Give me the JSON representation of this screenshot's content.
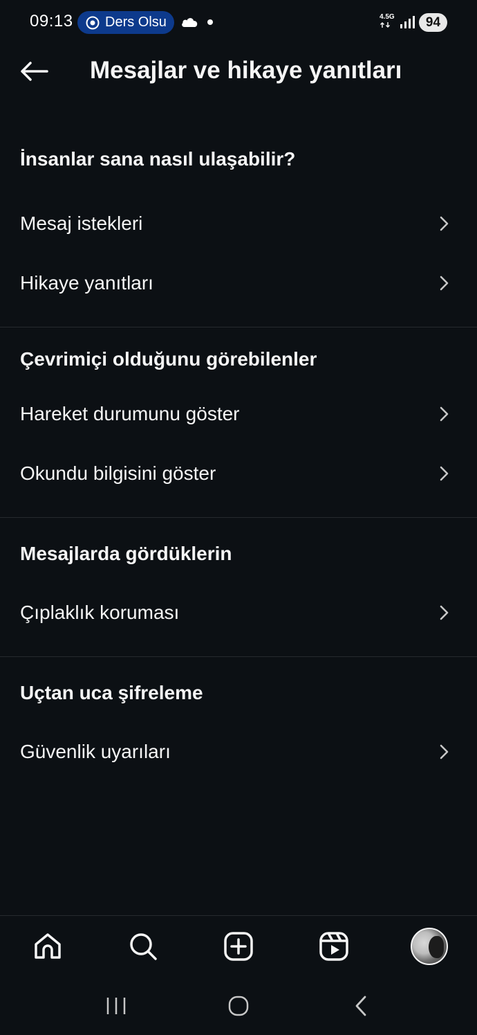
{
  "status_bar": {
    "time": "09:13",
    "pill_text": "Ders Olsu",
    "network": "4.5G",
    "battery": "94"
  },
  "header": {
    "title": "Mesajlar ve hikaye yanıtları"
  },
  "sections": [
    {
      "heading": "İnsanlar sana nasıl ulaşabilir?",
      "items": [
        {
          "label": "Mesaj istekleri"
        },
        {
          "label": "Hikaye yanıtları"
        }
      ]
    },
    {
      "heading": "Çevrimiçi olduğunu görebilenler",
      "items": [
        {
          "label": "Hareket durumunu göster"
        },
        {
          "label": "Okundu bilgisini göster"
        }
      ]
    },
    {
      "heading": "Mesajlarda gördüklerin",
      "items": [
        {
          "label": "Çıplaklık koruması"
        }
      ]
    },
    {
      "heading": "Uçtan uca şifreleme",
      "items": [
        {
          "label": "Güvenlik uyarıları"
        }
      ]
    }
  ],
  "bottom_nav": {
    "icons": [
      "home-icon",
      "search-icon",
      "create-post-icon",
      "reels-icon",
      "profile-avatar"
    ]
  },
  "colors": {
    "background": "#0c1014",
    "text": "#f5f5f5",
    "divider": "#262a2e",
    "pill": "#0d3a8c"
  }
}
